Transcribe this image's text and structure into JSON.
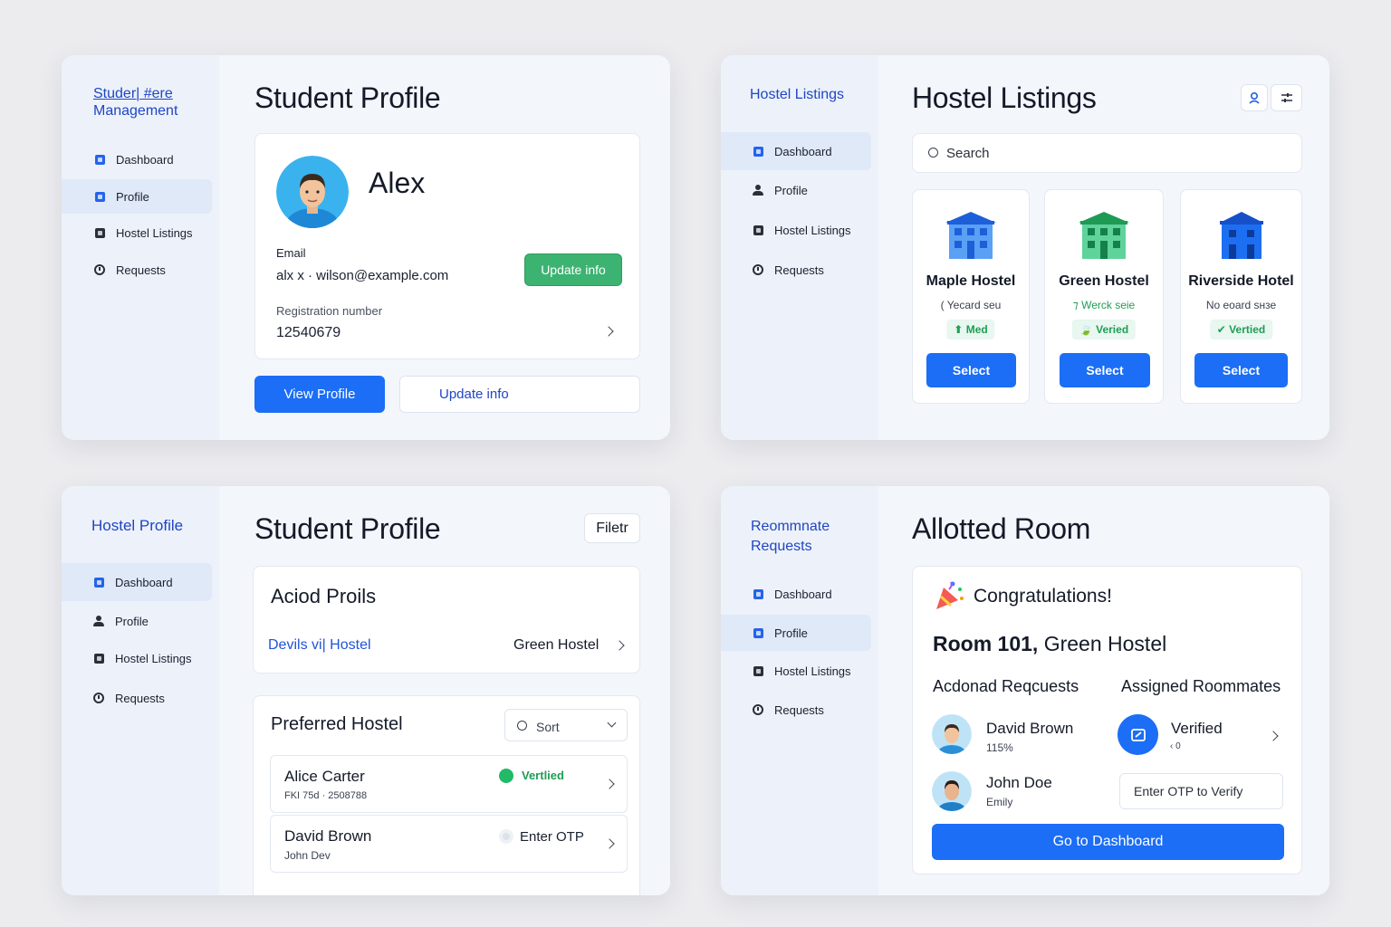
{
  "panel1": {
    "brand_line1": "Studer| #ere",
    "brand_line2": "Management",
    "nav": [
      "Dashboard",
      "Profile",
      "Hostel Listings",
      "Requests"
    ],
    "title": "Student Profile",
    "name": "Alex",
    "email_label": "Email",
    "email_value": "alx x · wilson@example.com",
    "update_info_green": "Update info",
    "reg_label": "Registration number",
    "reg_value": "12540679",
    "view_profile": "View Profile",
    "update_info": "Update info"
  },
  "panel2": {
    "brand": "Hostel Listings",
    "nav": [
      "Dashboard",
      "Profile",
      "Hostel Listings",
      "Requests"
    ],
    "title": "Hostel Listings",
    "search_placeholder": "Search",
    "hostels": [
      {
        "name": "Maple Hostel",
        "sub": "( Yecard seu",
        "badge": "Med",
        "select": "Select",
        "color": "#3b82f6"
      },
      {
        "name": "Green Hostel",
        "sub": "⁊ Werck seie",
        "badge": "Veried",
        "select": "Select",
        "color": "#22c55e"
      },
      {
        "name": "Riverside Hotel",
        "sub": "No eoard sнзе",
        "badge": "Vertied",
        "select": "Select",
        "color": "#1d6ff2"
      }
    ]
  },
  "panel3": {
    "brand": "Hostel Profile",
    "nav": [
      "Dashboard",
      "Profile",
      "Hostel Listings",
      "Requests"
    ],
    "title": "Student Profile",
    "filter": "Filetr",
    "section1_title": "Aciod Proils",
    "link": "Devils vi| Hostel",
    "hostel_value": "Green Hostel",
    "section2_title": "Preferred Hostel",
    "sort": "Sort",
    "rows": [
      {
        "name": "Alice Carter",
        "sub": "FKI 75d · 2508788",
        "status": "Vertlied"
      },
      {
        "name": "David Brown",
        "sub": "John Dev",
        "status": "Enter OTP"
      }
    ]
  },
  "panel4": {
    "brand_line1": "Reommnate",
    "brand_line2": "Requests",
    "nav": [
      "Dashboard",
      "Profile",
      "Hostel Listings",
      "Requests"
    ],
    "title": "Allotted Room",
    "congrats": "Congratulations!",
    "room_bold": "Room 101,",
    "room_rest": " Green Hostel",
    "col1_title": "Acdonad Reqcuests",
    "col2_title": "Assigned Roommates",
    "people": [
      {
        "name": "David Brown",
        "sub": "115%"
      },
      {
        "name": "John Doe",
        "sub": "Emily"
      }
    ],
    "verified": "Verified",
    "verified_sub": "0",
    "otp_placeholder": "Enter OTP to Verify",
    "go_dashboard": "Go to Dashboard"
  },
  "colors": {
    "accent": "#1b6ef5",
    "success": "#22a35a",
    "brand_text": "#1f45c4"
  },
  "icons": [
    "dashboard-icon",
    "profile-icon",
    "listings-icon",
    "requests-icon",
    "search-icon",
    "filter-icon",
    "user-circle-icon",
    "party-popper-icon",
    "chevron-right-icon"
  ]
}
